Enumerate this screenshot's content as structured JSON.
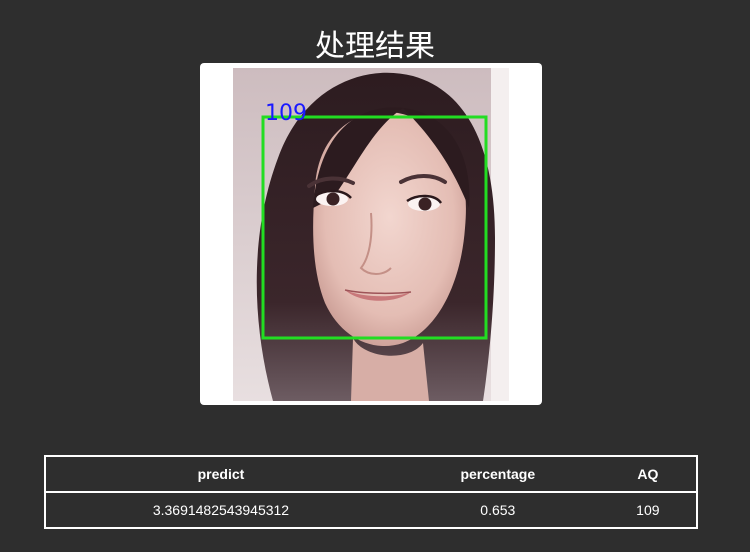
{
  "page": {
    "title": "处理结果"
  },
  "result_image": {
    "overlay_label": "109",
    "box_color": "#22dd22",
    "label_color": "#1a1aff"
  },
  "results_table": {
    "headers": [
      "predict",
      "percentage",
      "AQ"
    ],
    "rows": [
      [
        "3.3691482543945312",
        "0.653",
        "109"
      ]
    ]
  }
}
